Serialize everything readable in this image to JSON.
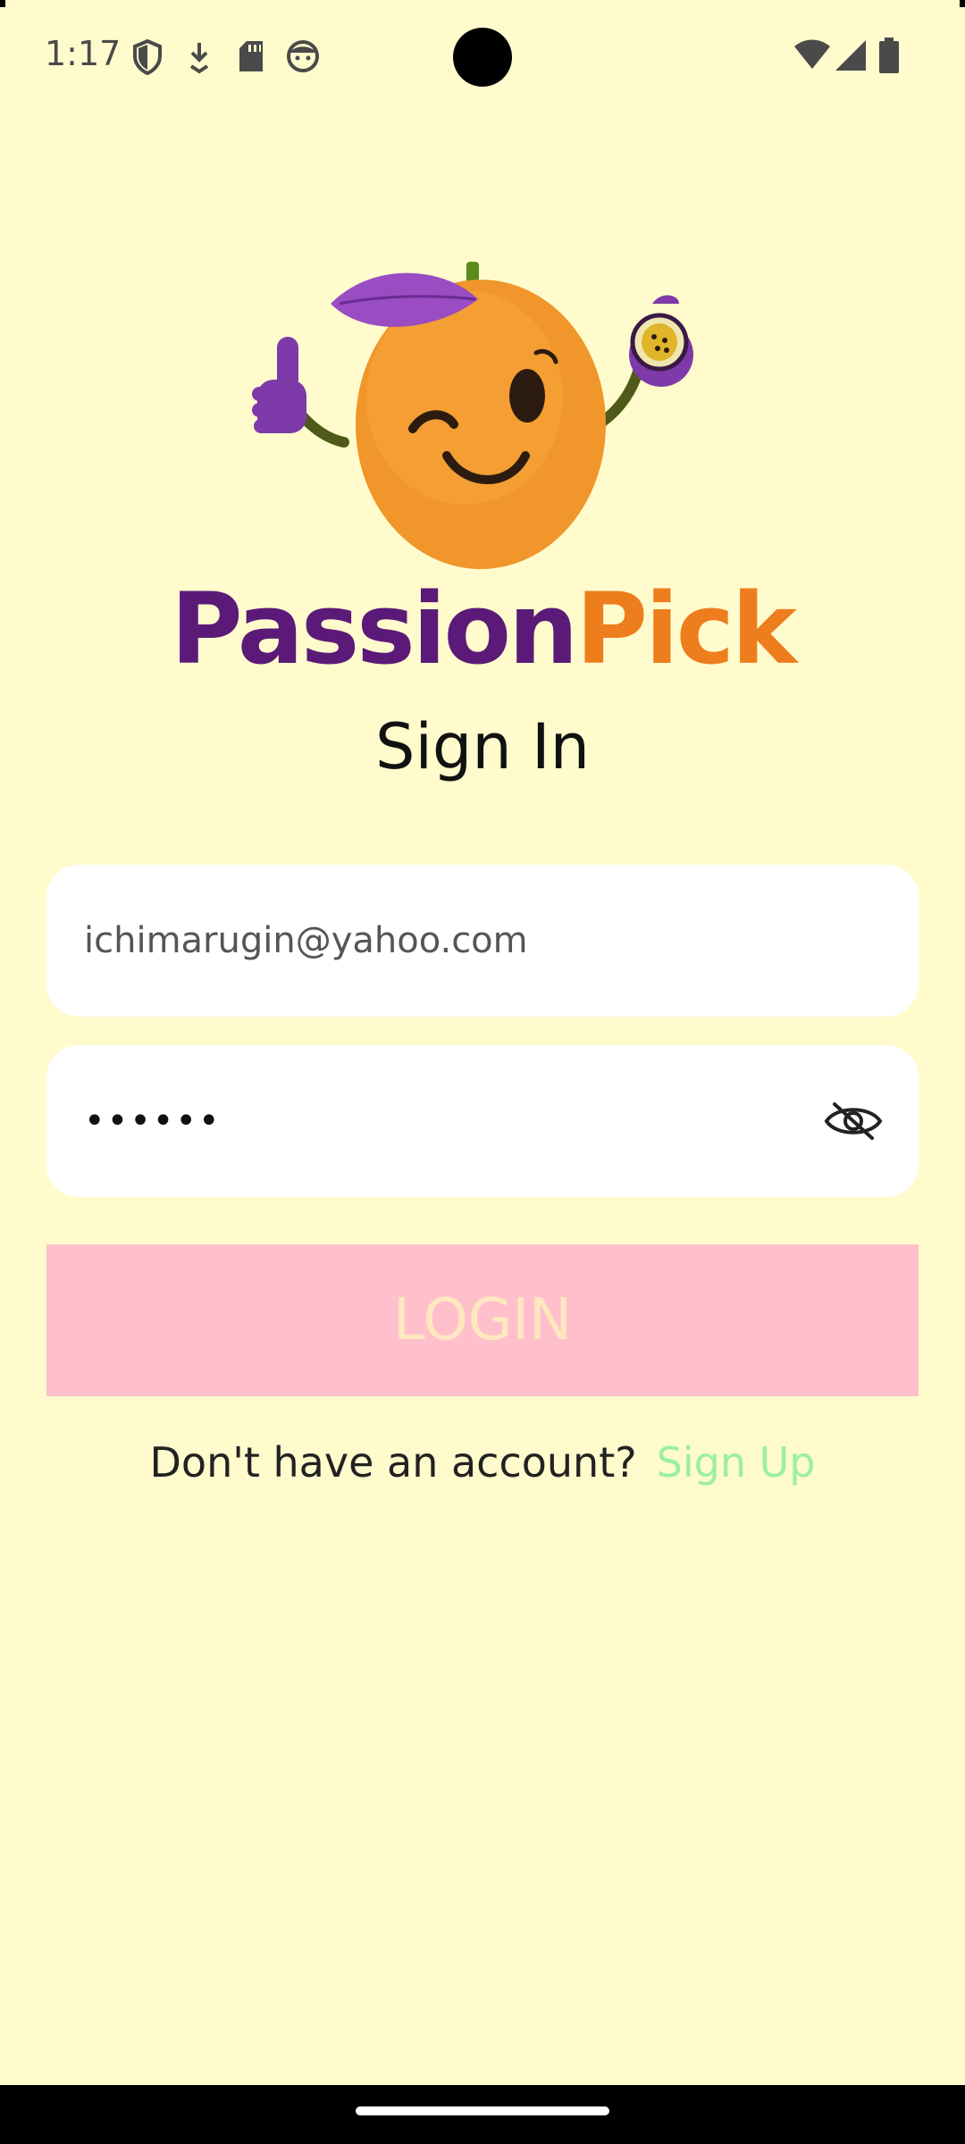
{
  "status_bar": {
    "time": "1:17",
    "icons": [
      "shield-icon",
      "download-icon",
      "sd-card-icon",
      "face-icon",
      "wifi-icon",
      "signal-icon",
      "battery-icon"
    ]
  },
  "brand": {
    "part1": "Passion",
    "part2": "Pick",
    "colors": {
      "part1": "#5b1a78",
      "part2": "#ee7d1e"
    }
  },
  "form": {
    "title": "Sign In",
    "email_value": "ichimarugin@yahoo.com",
    "password_value": "••••••",
    "login_label": "LOGIN"
  },
  "signup": {
    "question": "Don't have an account?",
    "link_label": "Sign Up"
  },
  "colors": {
    "background": "#fffbcd",
    "login_button": "#ffc0cb",
    "signup_link": "#9af0a0"
  }
}
